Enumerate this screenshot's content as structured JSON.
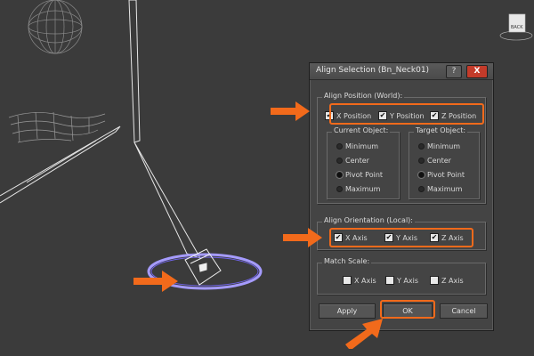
{
  "dialog": {
    "title": "Align Selection (Bn_Neck01)",
    "help_label": "?",
    "close_label": "X"
  },
  "align_position": {
    "group_label": "Align Position (World):",
    "x": {
      "label": "X Position",
      "checked": true
    },
    "y": {
      "label": "Y Position",
      "checked": true
    },
    "z": {
      "label": "Z Position",
      "checked": true
    },
    "current_object": {
      "label": "Current Object:",
      "options": [
        "Minimum",
        "Center",
        "Pivot Point",
        "Maximum"
      ],
      "selected": "Pivot Point"
    },
    "target_object": {
      "label": "Target Object:",
      "options": [
        "Minimum",
        "Center",
        "Pivot Point",
        "Maximum"
      ],
      "selected": "Pivot Point"
    }
  },
  "align_orientation": {
    "group_label": "Align Orientation (Local):",
    "x": {
      "label": "X Axis",
      "checked": true
    },
    "y": {
      "label": "Y Axis",
      "checked": true
    },
    "z": {
      "label": "Z Axis",
      "checked": true
    }
  },
  "match_scale": {
    "group_label": "Match Scale:",
    "x": {
      "label": "X Axis",
      "checked": false
    },
    "y": {
      "label": "Y Axis",
      "checked": false
    },
    "z": {
      "label": "Z Axis",
      "checked": false
    }
  },
  "buttons": {
    "apply": "Apply",
    "ok": "OK",
    "cancel": "Cancel"
  },
  "colors": {
    "highlight": "#f26a1b",
    "viewport_bg": "#3b3b3b",
    "dialog_bg": "#444444"
  },
  "icons": [
    "arrow-right-icon",
    "arrow-up-right-icon",
    "help-icon",
    "close-icon"
  ]
}
